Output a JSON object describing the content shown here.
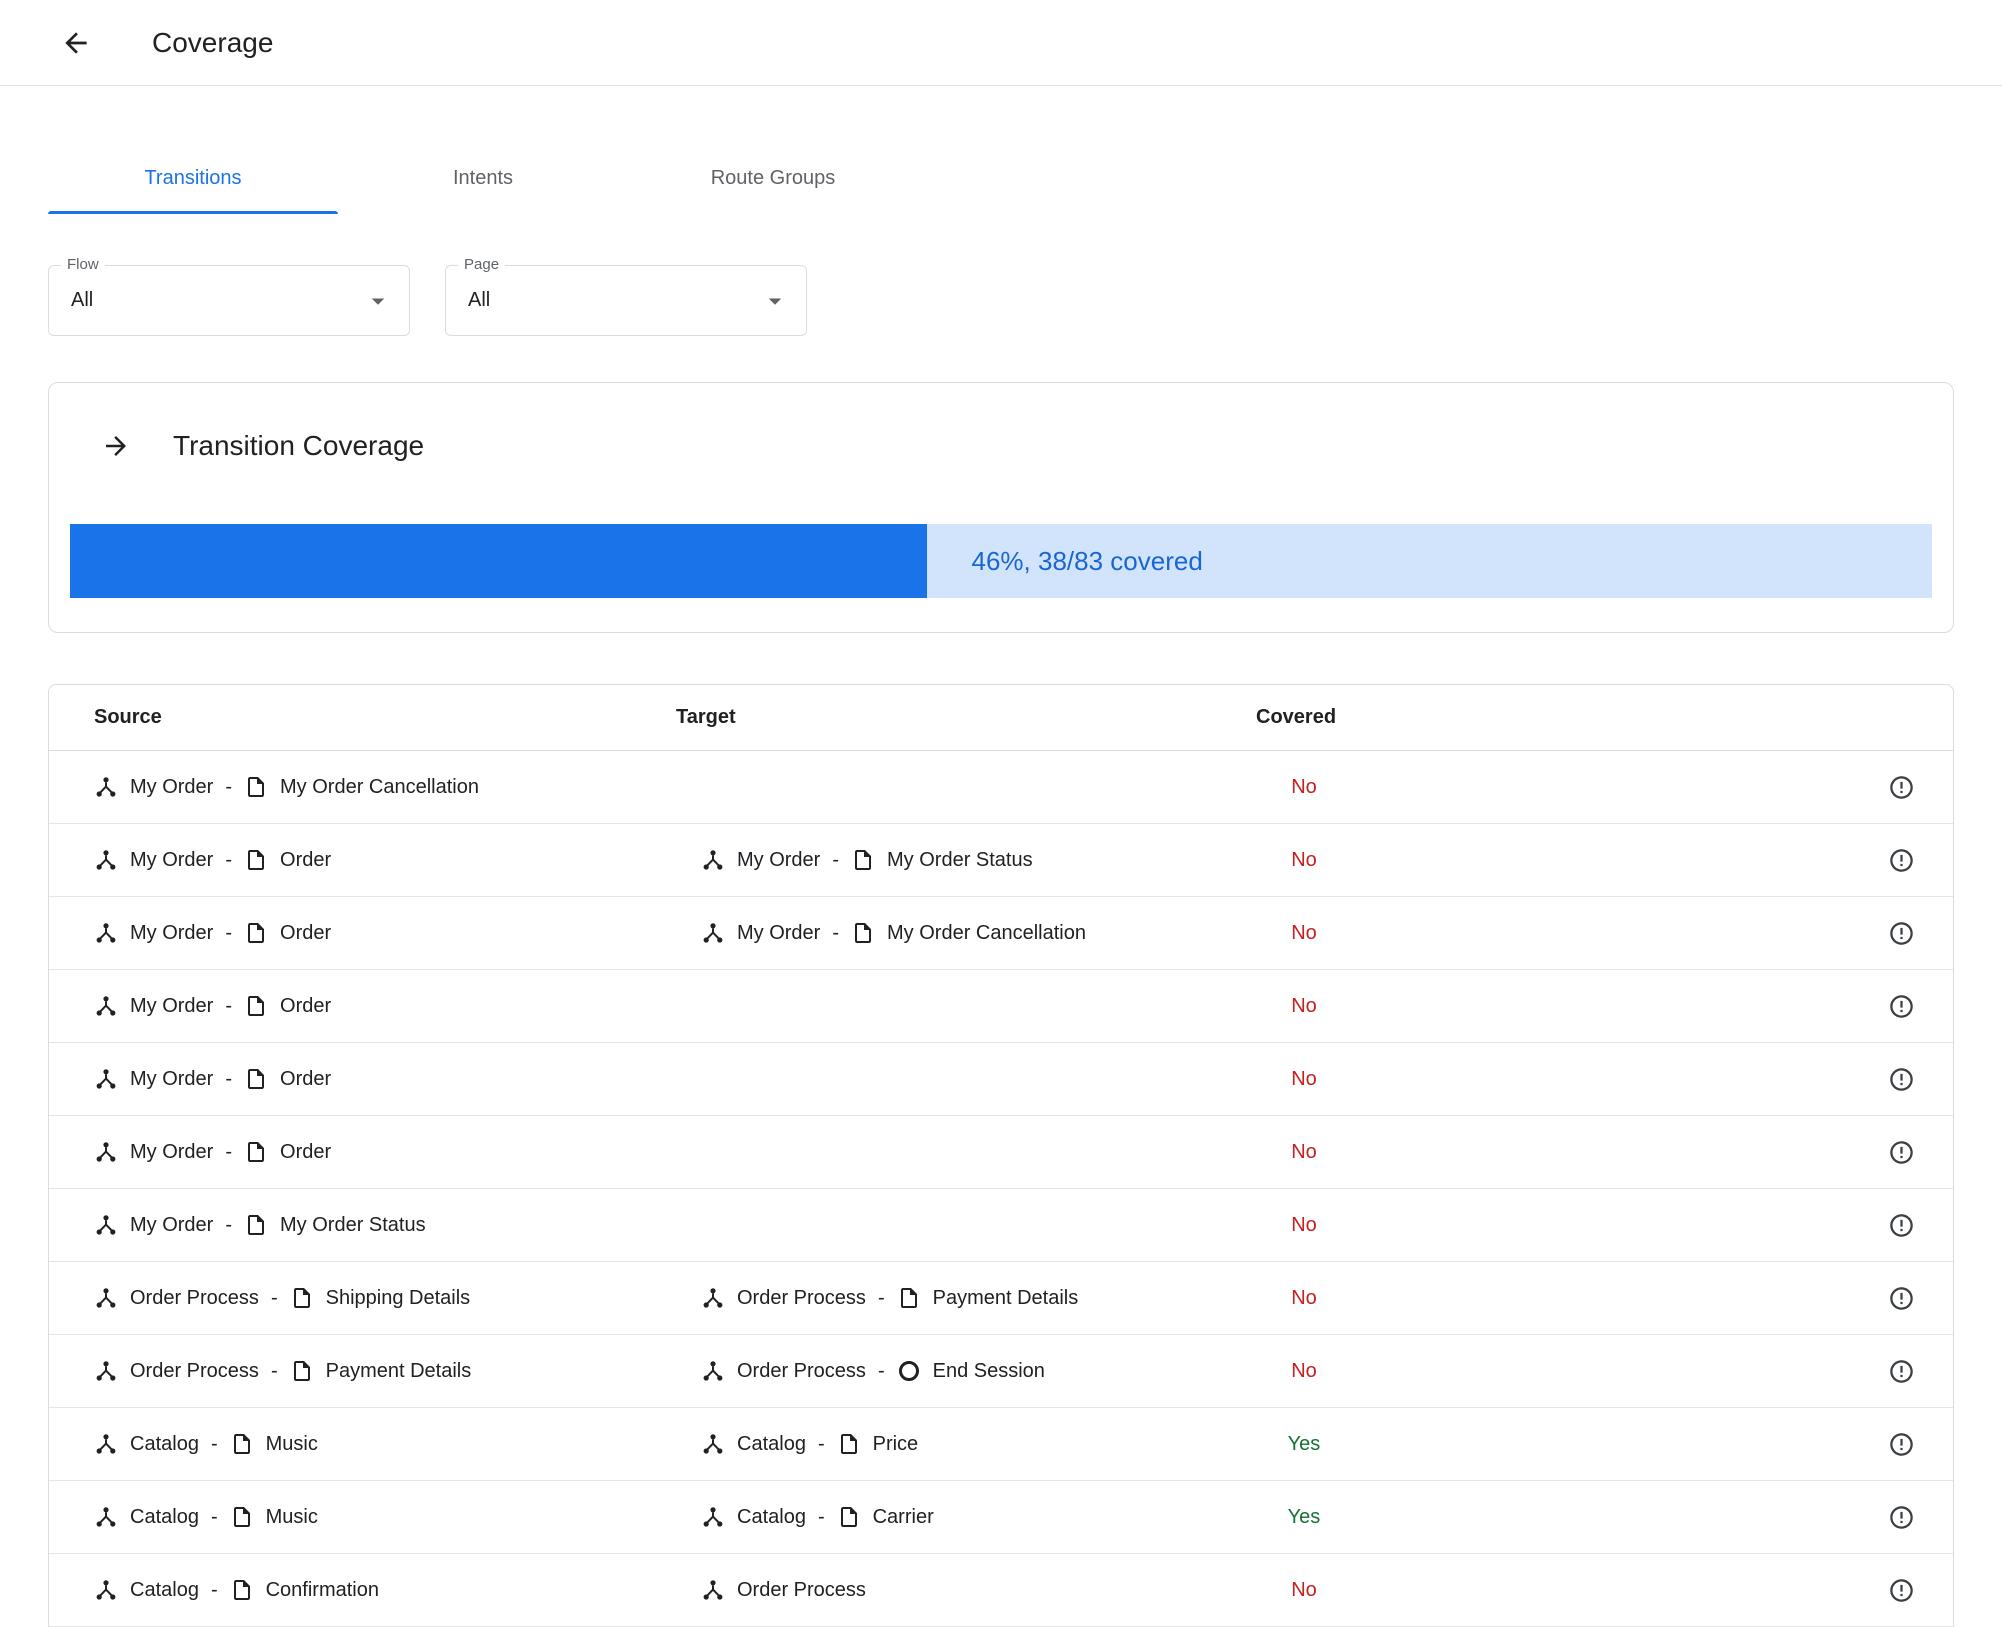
{
  "header": {
    "title": "Coverage"
  },
  "tabs": [
    {
      "label": "Transitions",
      "active": true
    },
    {
      "label": "Intents",
      "active": false
    },
    {
      "label": "Route Groups",
      "active": false
    }
  ],
  "filters": [
    {
      "label": "Flow",
      "value": "All"
    },
    {
      "label": "Page",
      "value": "All"
    }
  ],
  "coverage_card": {
    "title": "Transition Coverage",
    "percent": 46,
    "covered_count": 38,
    "total_count": 83,
    "progress_label": "46%, 38/83 covered"
  },
  "table": {
    "columns": [
      "Source",
      "Target",
      "Covered"
    ],
    "separator": "-",
    "rows": [
      {
        "source": {
          "flow": "My Order",
          "page": "My Order Cancellation"
        },
        "target": null,
        "covered": "No"
      },
      {
        "source": {
          "flow": "My Order",
          "page": "Order"
        },
        "target": {
          "flow": "My Order",
          "page": "My Order Status"
        },
        "covered": "No"
      },
      {
        "source": {
          "flow": "My Order",
          "page": "Order"
        },
        "target": {
          "flow": "My Order",
          "page": "My Order Cancellation"
        },
        "covered": "No"
      },
      {
        "source": {
          "flow": "My Order",
          "page": "Order"
        },
        "target": null,
        "covered": "No"
      },
      {
        "source": {
          "flow": "My Order",
          "page": "Order"
        },
        "target": null,
        "covered": "No"
      },
      {
        "source": {
          "flow": "My Order",
          "page": "Order"
        },
        "target": null,
        "covered": "No"
      },
      {
        "source": {
          "flow": "My Order",
          "page": "My Order Status"
        },
        "target": null,
        "covered": "No"
      },
      {
        "source": {
          "flow": "Order Process",
          "page": "Shipping Details"
        },
        "target": {
          "flow": "Order Process",
          "page": "Payment Details"
        },
        "covered": "No"
      },
      {
        "source": {
          "flow": "Order Process",
          "page": "Payment Details"
        },
        "target": {
          "flow": "Order Process",
          "page": "End Session",
          "icon": "end-session"
        },
        "covered": "No"
      },
      {
        "source": {
          "flow": "Catalog",
          "page": "Music"
        },
        "target": {
          "flow": "Catalog",
          "page": "Price"
        },
        "covered": "Yes"
      },
      {
        "source": {
          "flow": "Catalog",
          "page": "Music"
        },
        "target": {
          "flow": "Catalog",
          "page": "Carrier"
        },
        "covered": "Yes"
      },
      {
        "source": {
          "flow": "Catalog",
          "page": "Confirmation"
        },
        "target": {
          "flow": "Order Process",
          "page": null
        },
        "covered": "No"
      }
    ]
  },
  "colors": {
    "accent": "#1a73e8",
    "progress_track": "#d2e3fc",
    "progress_label": "#1967d2",
    "covered_no": "#c5221f",
    "covered_yes": "#137333"
  }
}
